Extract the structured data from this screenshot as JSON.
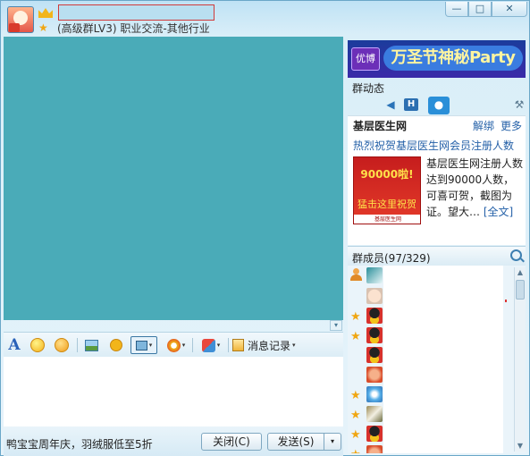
{
  "window": {
    "group_info": "(高级群LV3) 职业交流-其他行业",
    "controls": {
      "minimize": "—",
      "maximize": "□",
      "close": "✕"
    }
  },
  "chat": {
    "scroll_down": "▾",
    "toolbar": {
      "font": "A",
      "history": "消息记录",
      "history_caret": "▾",
      "caret": "▾"
    },
    "footer": {
      "ad_text": "鸭宝宝周年庆，羽绒服低至5折",
      "close_button": "关闭(C)",
      "send_button": "发送(S)",
      "send_menu": "▾"
    }
  },
  "sidebar": {
    "banner": {
      "logo": "优博",
      "text": "万圣节神秘Party"
    },
    "dynamics": {
      "title": "群动态",
      "tabs": {
        "sound": "◀",
        "h": "H",
        "chat": "●",
        "tool": "⚒"
      }
    },
    "news": {
      "site": "基层医生网",
      "unbind": "解绑",
      "more": "更多",
      "headline": "热烈祝贺基层医生网会员注册人数",
      "image_big": "90000啦!",
      "image_small": "猛击这里祝贺",
      "image_foot": "基层医生网 www.jys120.com",
      "body": "基层医生网注册人数达到90000人数，可喜可贺，截图为证。望大…",
      "fulltext_link": "[全文]"
    },
    "members": {
      "title": "群成员(97/329)",
      "scroll_up": "▲",
      "scroll_down": "▼"
    }
  },
  "colors": {
    "chat_background": "#4aabb8",
    "window_frame": "#bfe2f5",
    "link": "#2561a8"
  }
}
